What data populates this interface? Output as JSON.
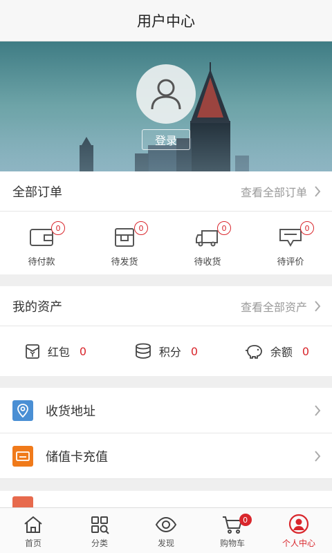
{
  "header": {
    "title": "用户中心"
  },
  "profile": {
    "login_label": "登录"
  },
  "orders": {
    "title": "全部订单",
    "more_label": "查看全部订单",
    "items": [
      {
        "label": "待付款",
        "count": "0",
        "icon": "wallet-icon"
      },
      {
        "label": "待发货",
        "count": "0",
        "icon": "package-icon"
      },
      {
        "label": "待收货",
        "count": "0",
        "icon": "truck-icon"
      },
      {
        "label": "待评价",
        "count": "0",
        "icon": "comment-icon"
      }
    ]
  },
  "assets": {
    "title": "我的资产",
    "more_label": "查看全部资产",
    "items": [
      {
        "label": "红包",
        "value": "0",
        "icon": "red-envelope-icon"
      },
      {
        "label": "积分",
        "value": "0",
        "icon": "coins-icon"
      },
      {
        "label": "余额",
        "value": "0",
        "icon": "piggy-bank-icon"
      }
    ]
  },
  "menu": [
    {
      "label": "收货地址",
      "icon": "location-pin-icon",
      "color": "#4a8fd4"
    },
    {
      "label": "储值卡充值",
      "icon": "card-icon",
      "color": "#f07a1a"
    }
  ],
  "tabbar": {
    "items": [
      {
        "label": "首页",
        "icon": "home-icon"
      },
      {
        "label": "分类",
        "icon": "category-icon"
      },
      {
        "label": "发现",
        "icon": "eye-icon"
      },
      {
        "label": "购物车",
        "icon": "cart-icon",
        "badge": "0"
      },
      {
        "label": "个人中心",
        "icon": "user-icon",
        "active": true
      }
    ]
  },
  "colors": {
    "accent": "#d9262c"
  }
}
